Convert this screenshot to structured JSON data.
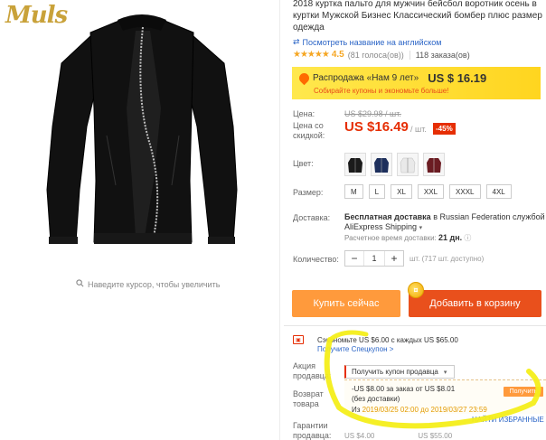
{
  "brand": {
    "logo_text": "Muls",
    "accent": "#c9a23a"
  },
  "product": {
    "title": "2018 куртка пальто для мужчин бейсбол воротник осень в куртки Мужской Бизнес Классический бомбер плюс размер одежда",
    "zoom_hint": "Наведите курсор, чтобы увеличить",
    "translate_link": "Посмотреть название на английском",
    "rating": {
      "stars": 4.5,
      "value": "4.5",
      "votes": "(81 голоса(ов))",
      "orders": "118 заказа(ов)"
    }
  },
  "sale": {
    "label": "Распродажа «Нам 9 лет»",
    "price": "US $ 16.19",
    "subtext": "Собирайте купоны и экономьте больше!"
  },
  "price": {
    "label_price": "Цена:",
    "old": "US $29.98 / шт.",
    "label_discount": "Цена со скидкой:",
    "current": "US $16.49",
    "unit": "/ шт.",
    "discount_badge": "-45%"
  },
  "colors": {
    "label": "Цвет:",
    "items": [
      {
        "name": "black",
        "hex": "#1b1b1b"
      },
      {
        "name": "navy",
        "hex": "#1d2f5c"
      },
      {
        "name": "white",
        "hex": "#e9e9e9"
      },
      {
        "name": "burgundy",
        "hex": "#6b1c22"
      }
    ]
  },
  "sizes": {
    "label": "Размер:",
    "items": [
      "M",
      "L",
      "XL",
      "XXL",
      "XXXL",
      "4XL"
    ]
  },
  "shipping": {
    "label": "Доставка:",
    "free": "Бесплатная доставка",
    "to": "в Russian Federation службой AliExpress Shipping",
    "time_label": "Расчетное время доставки:",
    "time_value": "21 дн."
  },
  "quantity": {
    "label": "Количество:",
    "value": "1",
    "minus": "−",
    "plus": "+",
    "note": "шт. (717 шт. доступно)"
  },
  "actions": {
    "buy": "Купить сейчас",
    "cart": "Добавить в корзину"
  },
  "savings": {
    "icon": "coupon-icon",
    "text": "Сэкономьте US $6.00 с каждых US $65.00",
    "link": "Получите Спецкупон >"
  },
  "seller_promo": {
    "label": "Акция продавца:",
    "select": "Получить купон продавца",
    "return_label": "Возврат товара",
    "coupon_line1": "-US $8.00 за заказ от US $8.01",
    "coupon_line2": "(без доставки)",
    "coupon_line3_prefix": "Из",
    "coupon_dates": "2019/03/25 02:00 до 2019/03/27 23:59",
    "get_button": "Получить",
    "find_link": "НАЙТИ ИЗБРАННЫЕ",
    "guarantee_label": "Гарантии продавца:",
    "bottom_left": "US $4.00",
    "bottom_right": "US $55.00"
  },
  "colors_ui": {
    "price_red": "#e62e04",
    "buy_orange": "#ff9a3c",
    "cart_orange": "#e9501c",
    "link_blue": "#2a64c6",
    "highlight_yellow": "#f4ee1a"
  }
}
